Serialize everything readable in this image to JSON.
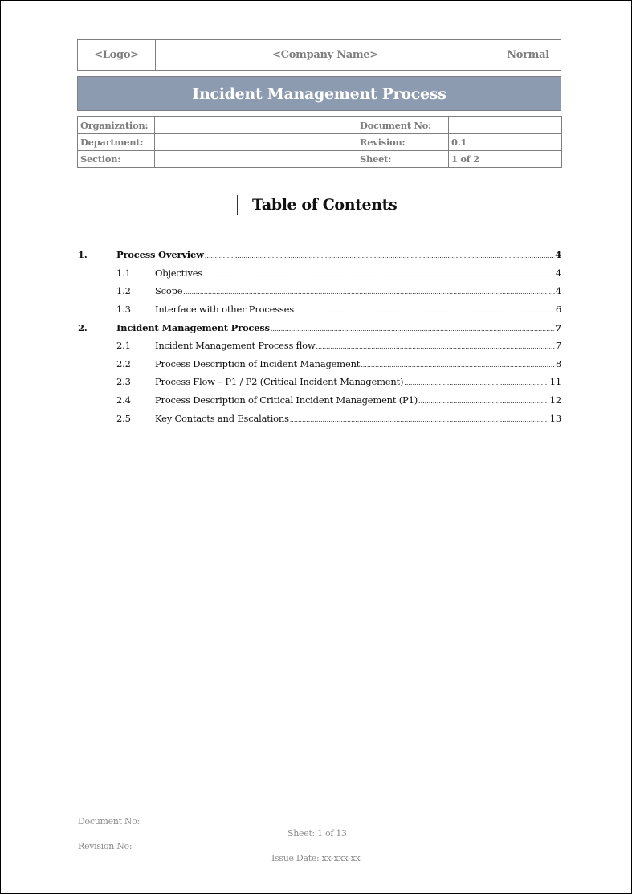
{
  "header": {
    "logo": "<Logo>",
    "company": "<Company Name>",
    "classification": "Normal"
  },
  "title": "Incident Management Process",
  "meta": {
    "organization_label": "Organization:",
    "organization_value": "",
    "document_no_label": "Document No:",
    "document_no_value": "",
    "department_label": "Department:",
    "department_value": "",
    "revision_label": "Revision:",
    "revision_value": "0.1",
    "section_label": "Section:",
    "section_value": "",
    "sheet_label": "Sheet:",
    "sheet_value": "1 of 2"
  },
  "toc": {
    "title": "Table of Contents",
    "entries": [
      {
        "num": "1.",
        "label": "Process Overview",
        "page": "4",
        "level": 1
      },
      {
        "num": "1.1",
        "label": "Objectives",
        "page": "4",
        "level": 2
      },
      {
        "num": "1.2",
        "label": "Scope",
        "page": "4",
        "level": 2
      },
      {
        "num": "1.3",
        "label": "Interface with other Processes",
        "page": "6",
        "level": 2
      },
      {
        "num": "2.",
        "label": "Incident Management Process",
        "page": "7",
        "level": 1
      },
      {
        "num": "2.1",
        "label": "Incident Management Process flow",
        "page": "7",
        "level": 2
      },
      {
        "num": "2.2",
        "label": "Process Description of Incident Management",
        "page": "8",
        "level": 2
      },
      {
        "num": "2.3",
        "label": "Process Flow – P1 / P2 (Critical Incident Management)",
        "page": "11",
        "level": 2
      },
      {
        "num": "2.4",
        "label": "Process Description of Critical Incident Management (P1)",
        "page": "12",
        "level": 2
      },
      {
        "num": "2.5",
        "label": "Key Contacts and Escalations",
        "page": "13",
        "level": 2
      }
    ]
  },
  "footer": {
    "document_no": "Document No:",
    "sheet": "Sheet: 1 of 13",
    "revision_no": "Revision No:",
    "issue_date": "Issue Date: xx-xxx-xx"
  }
}
